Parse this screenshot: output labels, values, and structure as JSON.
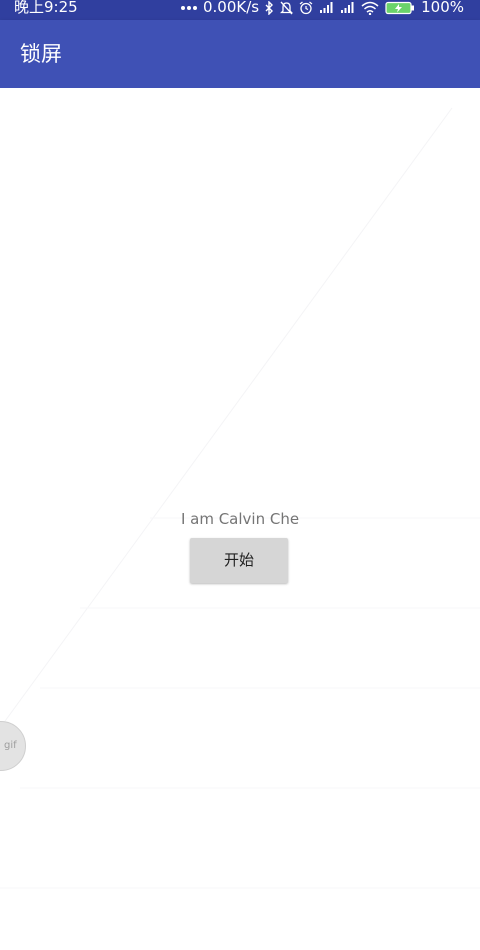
{
  "status_bar": {
    "time": "晚上9:25",
    "speed": "0.00K/s",
    "battery": "100%"
  },
  "app_bar": {
    "title": "锁屏"
  },
  "main": {
    "greeting": "I am Calvin Che",
    "start_button": "开始"
  },
  "overlay": {
    "gif_badge": "gif"
  },
  "colors": {
    "status_bar": "#303f9f",
    "app_bar": "#3f51b5",
    "button": "#d6d6d6",
    "greeting_text": "#757575"
  },
  "icons": [
    "more-dots-icon",
    "bluetooth-icon",
    "mute-icon",
    "alarm-icon",
    "signal-icon",
    "wifi-icon",
    "battery-charging-icon"
  ]
}
